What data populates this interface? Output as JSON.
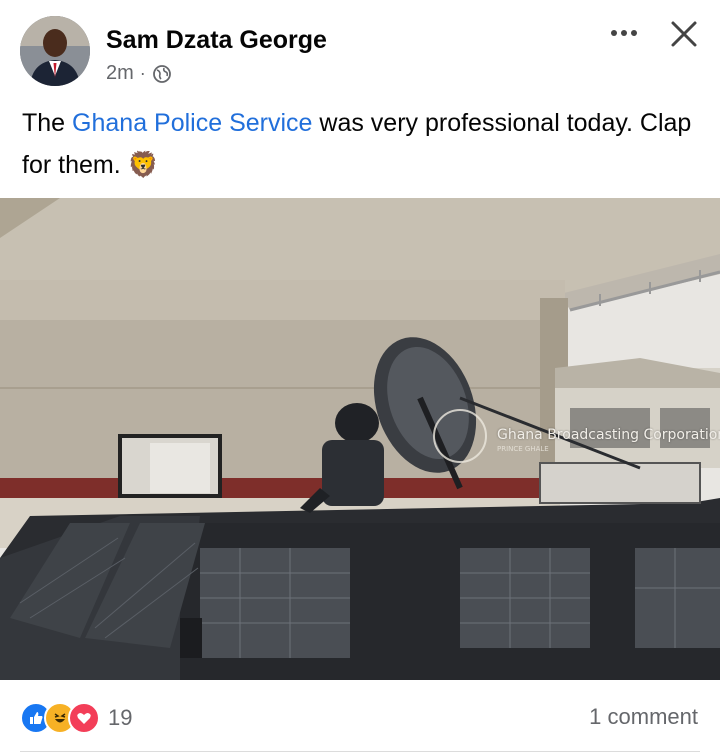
{
  "post": {
    "author": "Sam Dzata George",
    "time": "2m",
    "separator": "·",
    "visibility_icon": "globe-icon",
    "text_prefix": "The ",
    "text_link": "Ghana Police Service",
    "text_suffix": " was very professional today. Clap for them.",
    "emoji": "🦁"
  },
  "photo": {
    "watermark_main": "Ghana Broadcasting Corporation",
    "watermark_sub": "PRINCE GHALE"
  },
  "footer": {
    "reaction_icons": [
      "like-icon",
      "haha-icon",
      "love-icon"
    ],
    "reaction_count": "19",
    "comments": "1 comment"
  },
  "colors": {
    "link": "#216fdb",
    "like": "#1877f2",
    "love": "#f33e58",
    "haha": "#f7b125"
  }
}
